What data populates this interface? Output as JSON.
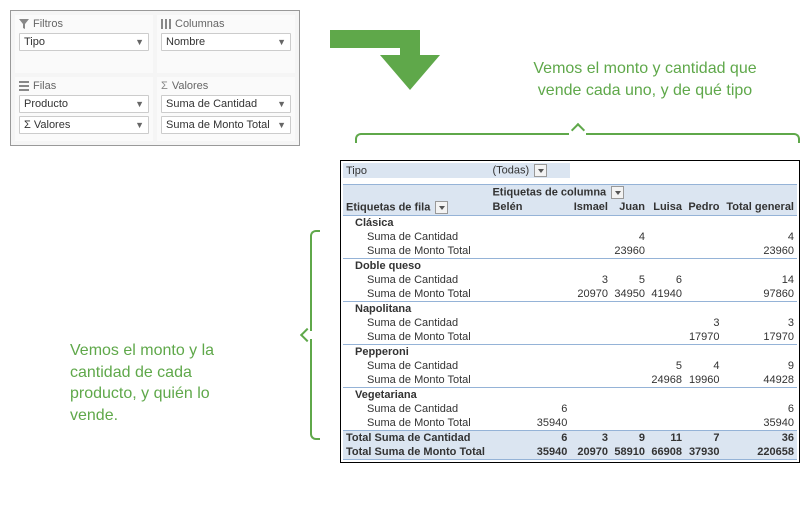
{
  "panel": {
    "filtros": {
      "label": "Filtros",
      "items": [
        "Tipo"
      ]
    },
    "columnas": {
      "label": "Columnas",
      "items": [
        "Nombre"
      ]
    },
    "filas": {
      "label": "Filas",
      "items": [
        "Producto",
        "Σ Valores"
      ]
    },
    "valores": {
      "label": "Valores",
      "items": [
        "Suma de Cantidad",
        "Suma de Monto Total"
      ]
    }
  },
  "annot": {
    "top": "Vemos el monto y cantidad que vende cada uno, y de qué tipo",
    "left": "Vemos el monto y la cantidad de cada producto, y quién lo vende."
  },
  "pivot": {
    "filter_field": "Tipo",
    "filter_value": "(Todas)",
    "col_label_title": "Etiquetas de columna",
    "row_label_title": "Etiquetas de fila",
    "measure_cantidad": "Suma de Cantidad",
    "measure_monto": "Suma de Monto Total",
    "grand_total_label": "Total general",
    "total_cantidad_label": "Total Suma de Cantidad",
    "total_monto_label": "Total Suma de Monto Total",
    "columns": [
      "Belén",
      "Ismael",
      "Juan",
      "Luisa",
      "Pedro"
    ],
    "groups": [
      {
        "name": "Clásica",
        "cantidad": [
          "",
          "",
          "4",
          "",
          ""
        ],
        "cantidad_total": "4",
        "monto": [
          "",
          "",
          "23960",
          "",
          ""
        ],
        "monto_total": "23960"
      },
      {
        "name": "Doble queso",
        "cantidad": [
          "",
          "3",
          "5",
          "6",
          ""
        ],
        "cantidad_total": "14",
        "monto": [
          "",
          "20970",
          "34950",
          "41940",
          ""
        ],
        "monto_total": "97860"
      },
      {
        "name": "Napolitana",
        "cantidad": [
          "",
          "",
          "",
          "",
          "3"
        ],
        "cantidad_total": "3",
        "monto": [
          "",
          "",
          "",
          "",
          "17970"
        ],
        "monto_total": "17970"
      },
      {
        "name": "Pepperoni",
        "cantidad": [
          "",
          "",
          "",
          "5",
          "4"
        ],
        "cantidad_total": "9",
        "monto": [
          "",
          "",
          "",
          "24968",
          "19960"
        ],
        "monto_total": "44928"
      },
      {
        "name": "Vegetariana",
        "cantidad": [
          "6",
          "",
          "",
          "",
          ""
        ],
        "cantidad_total": "6",
        "monto": [
          "35940",
          "",
          "",
          "",
          ""
        ],
        "monto_total": "35940"
      }
    ],
    "grand_cantidad": [
      "6",
      "3",
      "9",
      "11",
      "7"
    ],
    "grand_cantidad_total": "36",
    "grand_monto": [
      "35940",
      "20970",
      "58910",
      "66908",
      "37930"
    ],
    "grand_monto_total": "220658"
  }
}
